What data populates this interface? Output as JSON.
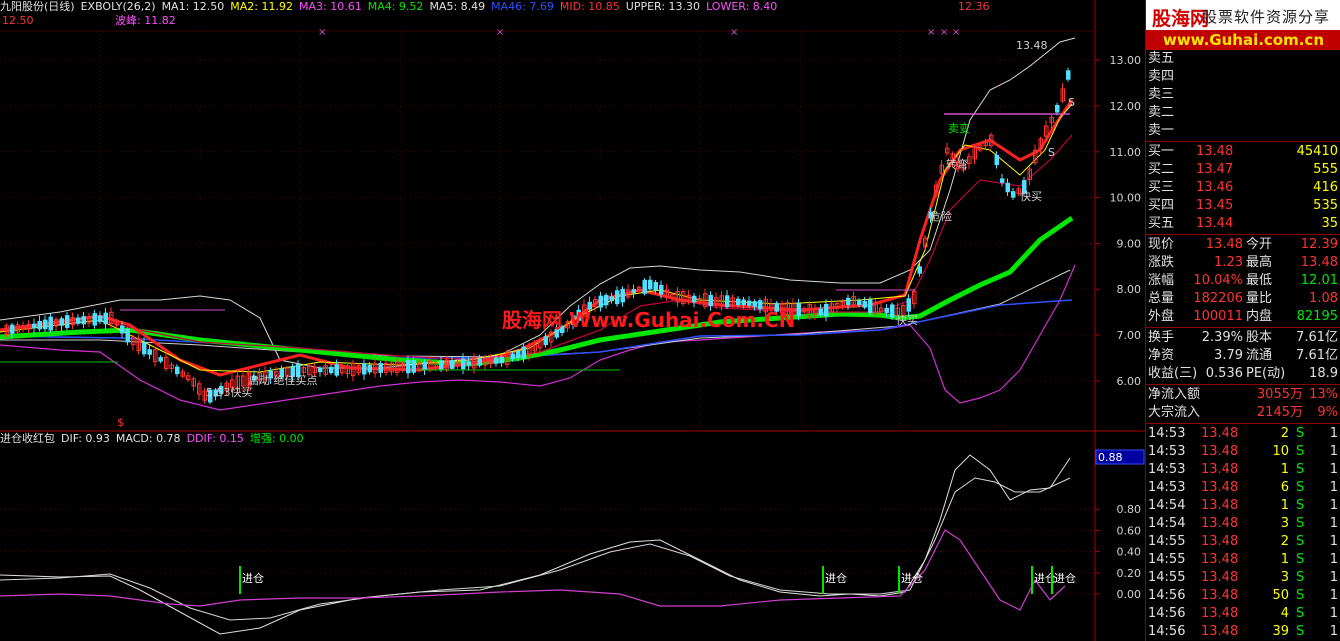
{
  "header_main": {
    "stock": "九阳股份(日线)",
    "indicator": "EXBOLY(26,2)",
    "ma1": "MA1: 12.50",
    "ma2": "MA2: 11.92",
    "ma3": "MA3: 10.61",
    "ma4": "MA4: 9.52",
    "ma5": "MA5: 8.49",
    "ma46": "MA46: 7.69",
    "mid": "MID: 10.85",
    "upper": "UPPER: 13.30",
    "lower": "LOWER: 8.40",
    "right_value": "12.36",
    "sub_left": "12.50",
    "sub_wave": "波峰: 11.82",
    "arrow": "↑"
  },
  "header_sub": {
    "name": "进仓收红包",
    "dif": "DIF: 0.93",
    "macd": "MACD: 0.78",
    "ddif": "DDIF: 0.15",
    "zq": "增强: 0.00",
    "arrow": "↑"
  },
  "price_axis": [
    "13.00",
    "12.00",
    "11.00",
    "10.00",
    "9.00",
    "8.00",
    "7.00",
    "6.00"
  ],
  "macd_axis": [
    "0.80",
    "0.60",
    "0.40",
    "0.20",
    "0.00"
  ],
  "macd_current": "0.88",
  "annotations": {
    "high": "13.48",
    "watermark": "股海网 Www.Guhai.Com.CN",
    "jc": "进仓",
    "qd": "启动 绝佳买点",
    "kuaimai": "快买",
    "s_letter": "S",
    "dollar": "$",
    "x": "×",
    "low_note": "5.53快买",
    "maibian": "卖变",
    "jiayan": "危险",
    "zhuban": "转弯"
  },
  "logo": {
    "cn": "股海网",
    "sub": "股票软件资源分享",
    "url": "www.Guhai.com.cn"
  },
  "asks": [
    {
      "label": "卖五"
    },
    {
      "label": "卖四"
    },
    {
      "label": "卖三"
    },
    {
      "label": "卖二"
    },
    {
      "label": "卖一"
    }
  ],
  "bids": [
    {
      "label": "买一",
      "price": "13.48",
      "vol": "45410"
    },
    {
      "label": "买二",
      "price": "13.47",
      "vol": "555"
    },
    {
      "label": "买三",
      "price": "13.46",
      "vol": "416"
    },
    {
      "label": "买四",
      "price": "13.45",
      "vol": "535"
    },
    {
      "label": "买五",
      "price": "13.44",
      "vol": "35"
    }
  ],
  "quote": [
    {
      "l": "现价",
      "v": "13.48",
      "l2": "今开",
      "v2": "12.39"
    },
    {
      "l": "涨跌",
      "v": "1.23",
      "l2": "最高",
      "v2": "13.48"
    },
    {
      "l": "涨幅",
      "v": "10.04%",
      "l2": "最低",
      "v2": "12.01"
    },
    {
      "l": "总量",
      "v": "182206",
      "l2": "量比",
      "v2": "1.08"
    },
    {
      "l": "外盘",
      "v": "100011",
      "l2": "内盘",
      "v2": "82195"
    }
  ],
  "fin": [
    {
      "l": "换手",
      "v": "2.39%",
      "l2": "股本",
      "v2": "7.61亿"
    },
    {
      "l": "净资",
      "v": "3.79",
      "l2": "流通",
      "v2": "7.61亿"
    },
    {
      "l": "收益(三)",
      "v": "0.536",
      "l2": "PE(动)",
      "v2": "18.9"
    }
  ],
  "flow": [
    {
      "l": "净流入额",
      "v": "3055万",
      "p": "13%"
    },
    {
      "l": "大宗流入",
      "v": "2145万",
      "p": "9%"
    }
  ],
  "ticks": [
    {
      "t": "14:53",
      "p": "13.48",
      "v": "2",
      "s": "S",
      "n": "1"
    },
    {
      "t": "14:53",
      "p": "13.48",
      "v": "10",
      "s": "S",
      "n": "1"
    },
    {
      "t": "14:53",
      "p": "13.48",
      "v": "1",
      "s": "S",
      "n": "1"
    },
    {
      "t": "14:53",
      "p": "13.48",
      "v": "6",
      "s": "S",
      "n": "1"
    },
    {
      "t": "14:54",
      "p": "13.48",
      "v": "1",
      "s": "S",
      "n": "1"
    },
    {
      "t": "14:54",
      "p": "13.48",
      "v": "3",
      "s": "S",
      "n": "1"
    },
    {
      "t": "14:55",
      "p": "13.48",
      "v": "2",
      "s": "S",
      "n": "1"
    },
    {
      "t": "14:55",
      "p": "13.48",
      "v": "1",
      "s": "S",
      "n": "1"
    },
    {
      "t": "14:55",
      "p": "13.48",
      "v": "3",
      "s": "S",
      "n": "1"
    },
    {
      "t": "14:56",
      "p": "13.48",
      "v": "50",
      "s": "S",
      "n": "1"
    },
    {
      "t": "14:56",
      "p": "13.48",
      "v": "4",
      "s": "S",
      "n": "1"
    },
    {
      "t": "14:56",
      "p": "13.48",
      "v": "39",
      "s": "S",
      "n": "1"
    }
  ]
}
